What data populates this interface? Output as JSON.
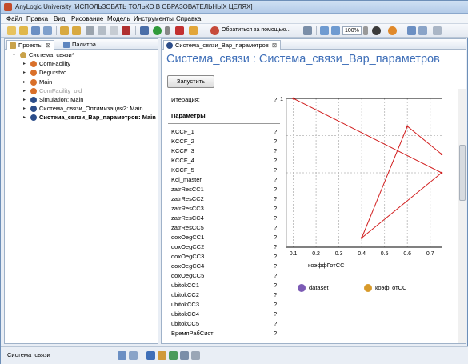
{
  "window": {
    "title": "AnyLogic University [ИСПОЛЬЗОВАТЬ ТОЛЬКО В ОБРАЗОВАТЕЛЬНЫХ ЦЕЛЯХ]"
  },
  "menu": [
    "Файл",
    "Правка",
    "Вид",
    "Рисование",
    "Модель",
    "Инструменты",
    "Справка"
  ],
  "toolbar": {
    "support_label": "Обратиться за помощью...",
    "zoom": "100%"
  },
  "left_panel": {
    "tabs": [
      {
        "label": "Проекты"
      },
      {
        "label": "Палитра"
      }
    ],
    "tree": [
      {
        "label": "Система_связи*",
        "level": 0,
        "bold": false,
        "color": "#000000",
        "icon": "model-icon"
      },
      {
        "label": "ComFacility",
        "level": 1,
        "bold": false,
        "color": "#000000",
        "icon": "agent-icon"
      },
      {
        "label": "Degurstvo",
        "level": 1,
        "bold": false,
        "color": "#000000",
        "icon": "agent-icon"
      },
      {
        "label": "Main",
        "level": 1,
        "bold": false,
        "color": "#000000",
        "icon": "agent-icon"
      },
      {
        "label": "ComFacility_old",
        "level": 1,
        "bold": false,
        "color": "#9a9a9a",
        "icon": "agent-icon"
      },
      {
        "label": "Simulation: Main",
        "level": 1,
        "bold": false,
        "color": "#000000",
        "icon": "experiment-icon"
      },
      {
        "label": "Система_связи_Оптимизация2: Main",
        "level": 1,
        "bold": false,
        "color": "#000000",
        "icon": "experiment-icon"
      },
      {
        "label": "Система_связи_Вар_параметров: Main",
        "level": 1,
        "bold": true,
        "color": "#000000",
        "icon": "experiment-icon"
      }
    ]
  },
  "editor": {
    "tab_label": "Система_связи_Вар_параметров",
    "heading": "Система_связи : Система_связи_Вар_параметров",
    "run_label": "Запустить",
    "iteration_label": "Итерация:",
    "iteration_value": "?",
    "params_label": "Параметры",
    "params": [
      {
        "name": "KCCF_1",
        "value": "?"
      },
      {
        "name": "KCCF_2",
        "value": "?"
      },
      {
        "name": "KCCF_3",
        "value": "?"
      },
      {
        "name": "KCCF_4",
        "value": "?"
      },
      {
        "name": "KCCF_5",
        "value": "?"
      },
      {
        "name": "Kol_master",
        "value": "?"
      },
      {
        "name": "zatrResCC1",
        "value": "?"
      },
      {
        "name": "zatrResCC2",
        "value": "?"
      },
      {
        "name": "zatrResCC3",
        "value": "?"
      },
      {
        "name": "zatrResCC4",
        "value": "?"
      },
      {
        "name": "zatrResCC5",
        "value": "?"
      },
      {
        "name": "doxOegCC1",
        "value": "?"
      },
      {
        "name": "doxOegCC2",
        "value": "?"
      },
      {
        "name": "doxOegCC3",
        "value": "?"
      },
      {
        "name": "doxOegCC4",
        "value": "?"
      },
      {
        "name": "doxOegCC5",
        "value": "?"
      },
      {
        "name": "ubitokCC1",
        "value": "?"
      },
      {
        "name": "ubitokCC2",
        "value": "?"
      },
      {
        "name": "ubitokCC3",
        "value": "?"
      },
      {
        "name": "ubitokCC4",
        "value": "?"
      },
      {
        "name": "ubitokCC5",
        "value": "?"
      },
      {
        "name": "ВремяРабСист",
        "value": "?"
      }
    ],
    "legend_series": "коэффГотСС",
    "dataset_label": "dataset",
    "variable_label": "коэфГотСС"
  },
  "status": {
    "label": "Система_связи"
  },
  "chart_data": {
    "type": "line",
    "series": [
      {
        "name": "коэфГотСС",
        "color": "#d22020",
        "x": [
          0.1,
          0.75,
          0.4,
          0.6,
          0.75
        ],
        "y": [
          1,
          0.6,
          0.25,
          0.85,
          0.7
        ]
      }
    ],
    "x_ticks": [
      "0.1",
      "0.2",
      "0.3",
      "0.4",
      "0.5",
      "0.6",
      "0.7"
    ],
    "y_ticks": [
      "1"
    ],
    "xlim": [
      0.07,
      0.75
    ],
    "ylim": [
      0.2,
      1.0
    ],
    "grid": true
  }
}
